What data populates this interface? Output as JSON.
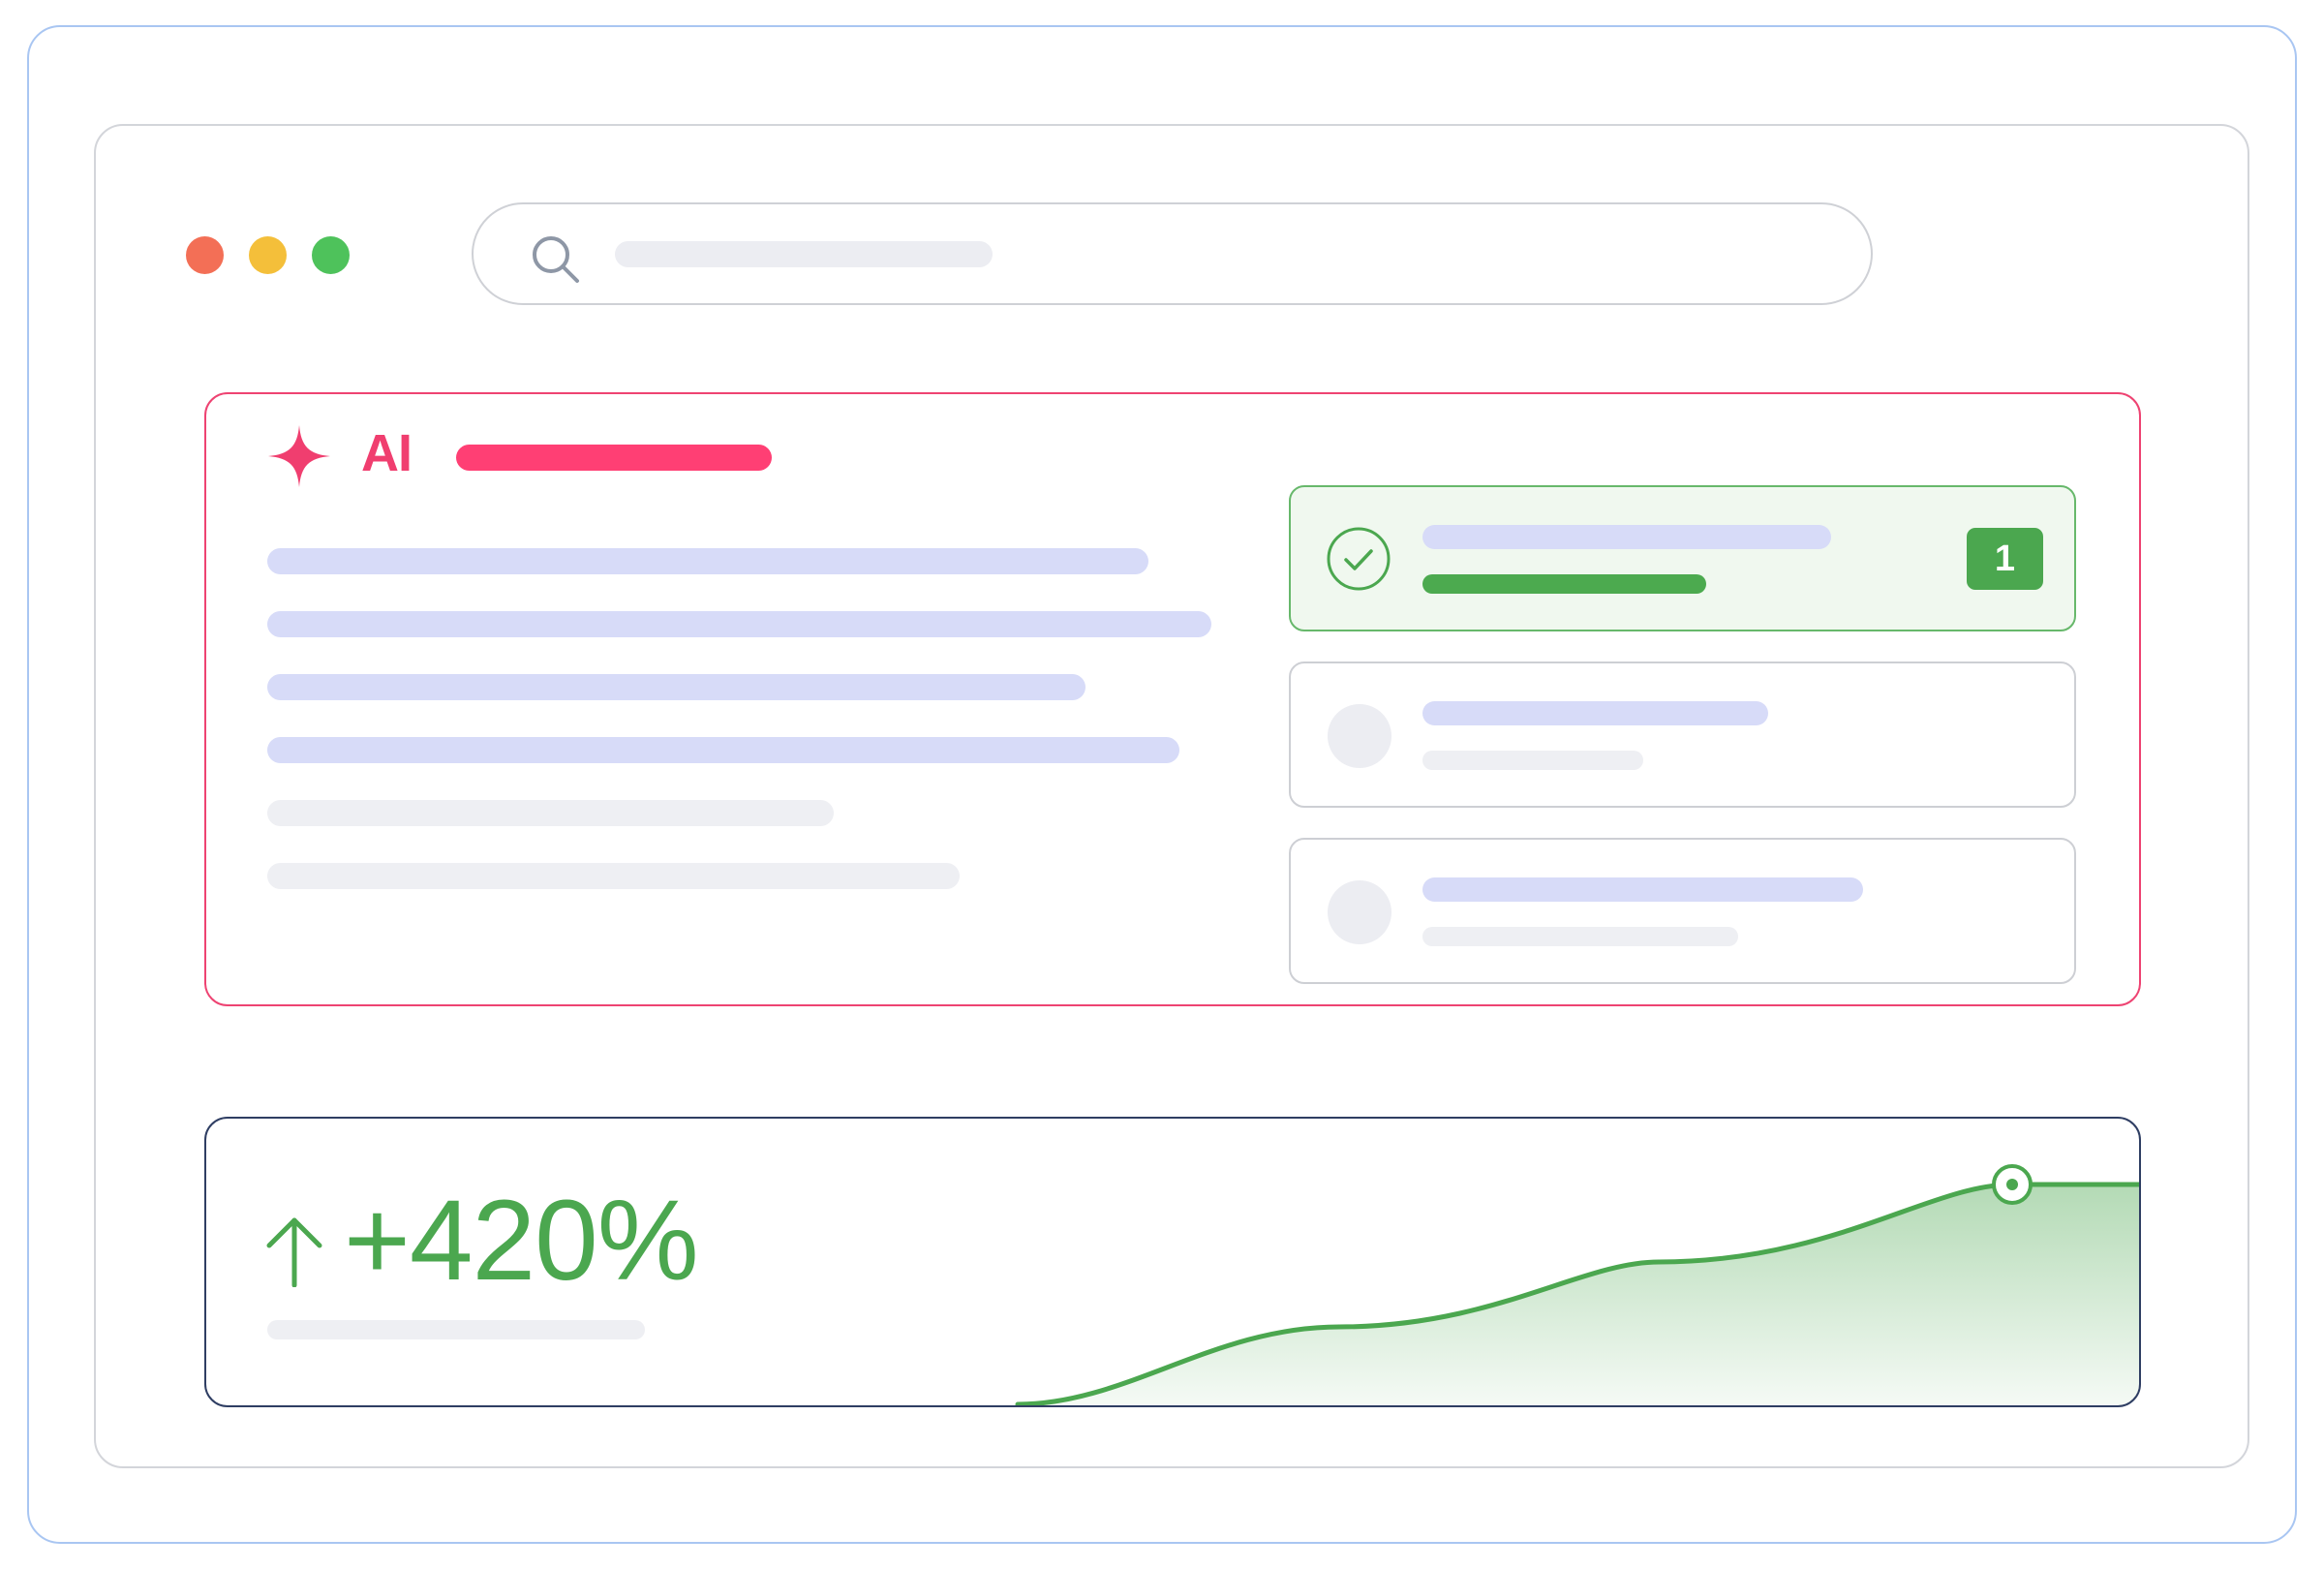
{
  "window": {
    "traffic_lights": [
      {
        "name": "close",
        "color": "#f36f56"
      },
      {
        "name": "minimize",
        "color": "#f4bf3a"
      },
      {
        "name": "maximize",
        "color": "#4ec25b"
      }
    ]
  },
  "search": {
    "icon": "search-icon",
    "value": ""
  },
  "ai_panel": {
    "icon": "sparkle-icon",
    "label": "AI",
    "accent_color": "#f03e6f",
    "results": [
      {
        "icon": "check-circle-icon",
        "selected": true,
        "badge": "1"
      },
      {
        "icon": "placeholder-circle",
        "selected": false
      },
      {
        "icon": "placeholder-circle",
        "selected": false
      }
    ]
  },
  "growth": {
    "icon": "arrow-up-icon",
    "value": "+420%",
    "color": "#4ba74f"
  }
}
